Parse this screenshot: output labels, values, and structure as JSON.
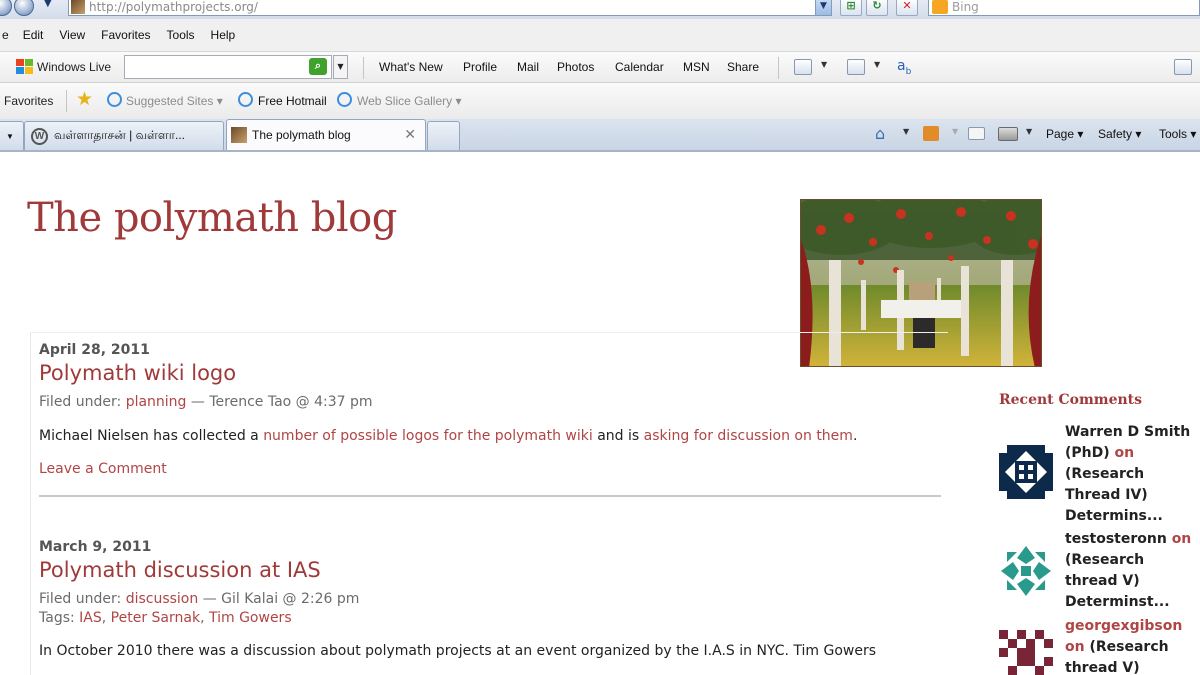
{
  "browser": {
    "address": "http://polymathprojects.org/",
    "search_placeholder": "Bing",
    "menu": [
      "e",
      "Edit",
      "View",
      "Favorites",
      "Tools",
      "Help"
    ],
    "windows_live": "Windows Live",
    "links": [
      "What's New",
      "Profile",
      "Mail",
      "Photos",
      "Calendar",
      "MSN",
      "Share"
    ],
    "favorites_label": "Favorites",
    "favorites_links": [
      "Suggested Sites ▾",
      "Free Hotmail",
      "Web Slice Gallery ▾"
    ],
    "tabs": [
      "வள்ளாதாசன் | வள்ளா...",
      "The polymath blog"
    ],
    "commands": [
      "Page ▾",
      "Safety ▾",
      "Tools ▾"
    ]
  },
  "blog": {
    "title": "The polymath blog",
    "posts": [
      {
        "date": "April 28, 2011",
        "title": "Polymath wiki logo",
        "filed_label": "Filed under: ",
        "category": "planning",
        "byline": " — Terence Tao @ 4:37 pm",
        "body_1": "Michael Nielsen has collected a ",
        "link_1": "number of possible logos for the polymath wiki",
        "body_2": " and is ",
        "link_2": "asking for discussion on them",
        "body_3": ".",
        "leave_comment": "Leave a Comment"
      },
      {
        "date": "March 9, 2011",
        "title": "Polymath discussion at IAS",
        "filed_label": "Filed under: ",
        "category": "discussion",
        "byline": " — Gil Kalai @ 2:26 pm",
        "tags_label": "Tags: ",
        "tags": [
          "IAS",
          "Peter Sarnak",
          "Tim Gowers"
        ],
        "body": "In October 2010 there was a discussion about polymath projects at an event organized by the I.A.S in NYC. Tim Gowers"
      }
    ]
  },
  "sidebar": {
    "title": "Recent Comments",
    "comments": [
      {
        "lines": [
          "Warren D Smith",
          "(PhD) ",
          "(Research",
          "Thread IV)",
          "Determins..."
        ],
        "on": "on"
      },
      {
        "lines": [
          "testosteronn ",
          "(Research",
          "thread V)",
          "Determinst..."
        ],
        "on": "on"
      },
      {
        "lines": [
          "georgexgibson",
          " (Research",
          "thread V)"
        ],
        "on": "on"
      }
    ]
  },
  "colors": {
    "accent": "#a03a3a",
    "link": "#b04545"
  }
}
